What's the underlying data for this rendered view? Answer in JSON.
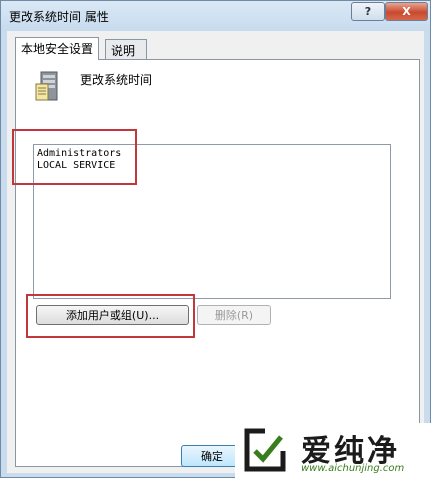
{
  "window": {
    "title": "更改系统时间 属性",
    "help_label": "?",
    "close_label": "X"
  },
  "tabs": [
    {
      "label": "本地安全设置",
      "active": true
    },
    {
      "label": "说明",
      "active": false
    }
  ],
  "policy": {
    "icon": "policy-server-icon",
    "name": "更改系统时间"
  },
  "accounts": [
    "Administrators",
    "LOCAL SERVICE"
  ],
  "buttons": {
    "add_label": "添加用户或组(U)...",
    "remove_label": "删除(R)",
    "ok_label": "确定"
  },
  "watermark": {
    "text": "爱纯净",
    "url": "www.aichunjing.com"
  },
  "colors": {
    "highlight": "#c2373c",
    "window_frame": "#c9dced",
    "watermark_green": "#3a7d1e"
  }
}
